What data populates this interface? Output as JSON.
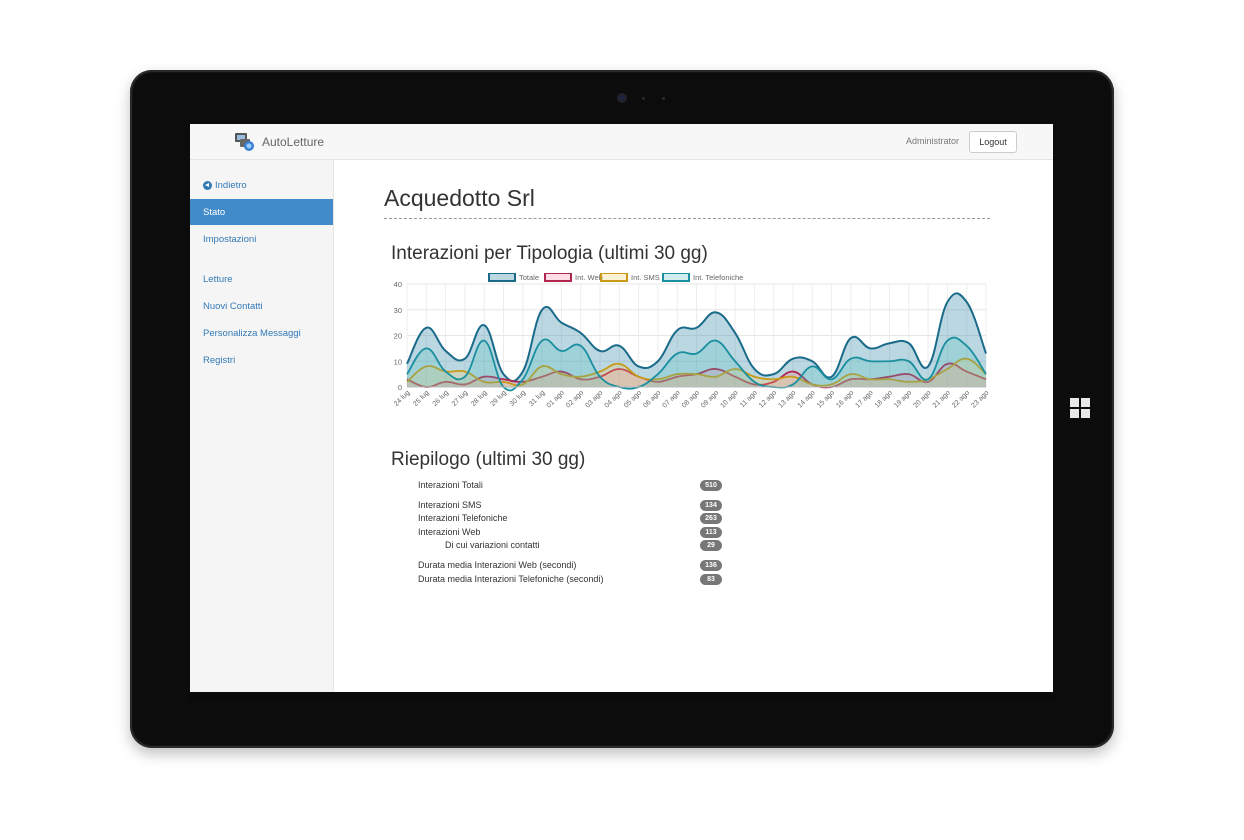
{
  "app": {
    "brand": "AutoLetture",
    "user": "Administrator",
    "logout_label": "Logout"
  },
  "sidebar": {
    "back_label": "Indietro",
    "items": [
      {
        "label": "Stato",
        "active": true
      },
      {
        "label": "Impostazioni",
        "active": false
      },
      {
        "label": "Letture",
        "active": false
      },
      {
        "label": "Nuovi Contatti",
        "active": false
      },
      {
        "label": "Personalizza Messaggi",
        "active": false
      },
      {
        "label": "Registri",
        "active": false
      }
    ]
  },
  "page": {
    "title": "Acquedotto Srl",
    "chart_title": "Interazioni per Tipologia (ultimi 30 gg)",
    "summary_title": "Riepilogo (ultimi 30 gg)"
  },
  "summary": [
    {
      "label": "Interazioni Totali",
      "value": "510",
      "indent": false
    },
    {
      "label": "Interazioni SMS",
      "value": "134",
      "indent": false
    },
    {
      "label": "Interazioni Telefoniche",
      "value": "263",
      "indent": false
    },
    {
      "label": "Interazioni Web",
      "value": "113",
      "indent": false
    },
    {
      "label": "Di cui variazioni contatti",
      "value": "29",
      "indent": true
    },
    {
      "label": "Durata media Interazioni Web (secondi)",
      "value": "136",
      "indent": false
    },
    {
      "label": "Durata media Interazioni Telefoniche (secondi)",
      "value": "83",
      "indent": false
    }
  ],
  "chart_data": {
    "type": "area",
    "categories": [
      "24 lug",
      "25 lug",
      "26 lug",
      "27 lug",
      "28 lug",
      "29 lug",
      "30 lug",
      "31 lug",
      "01 ago",
      "02 ago",
      "03 ago",
      "04 ago",
      "05 ago",
      "06 ago",
      "07 ago",
      "08 ago",
      "09 ago",
      "10 ago",
      "11 ago",
      "12 ago",
      "13 ago",
      "14 ago",
      "15 ago",
      "16 ago",
      "17 ago",
      "18 ago",
      "19 ago",
      "20 ago",
      "21 ago",
      "22 ago",
      "23 ago"
    ],
    "ylim": [
      0,
      40
    ],
    "yticks": [
      0,
      10,
      20,
      30,
      40
    ],
    "grid": true,
    "legend_position": "top",
    "series": [
      {
        "name": "Totale",
        "color": "#1a6b8a",
        "fill": "rgba(60,141,172,0.35)",
        "values": [
          9,
          23,
          14,
          11,
          24,
          5,
          6,
          30,
          25,
          21,
          14,
          16,
          8,
          10,
          22,
          23,
          29,
          21,
          7,
          5,
          11,
          10,
          4,
          19,
          15,
          17,
          17,
          8,
          33,
          33,
          13
        ]
      },
      {
        "name": "Int. Web",
        "color": "#b0264f",
        "fill": "rgba(255,120,150,0.25)",
        "values": [
          3,
          0,
          2,
          1,
          4,
          3,
          2,
          4,
          6,
          3,
          4,
          7,
          4,
          2,
          4,
          5,
          7,
          4,
          1,
          2,
          6,
          1,
          0,
          3,
          3,
          4,
          5,
          2,
          9,
          6,
          3
        ]
      },
      {
        "name": "Int. SMS",
        "color": "#c79a18",
        "fill": "rgba(255,206,86,0.25)",
        "values": [
          2,
          8,
          6,
          6,
          2,
          2,
          1,
          8,
          5,
          4,
          6,
          9,
          4,
          3,
          5,
          5,
          4,
          7,
          4,
          3,
          4,
          1,
          1,
          5,
          3,
          3,
          2,
          3,
          7,
          11,
          5
        ]
      },
      {
        "name": "Int. Telefoniche",
        "color": "#1a8fa0",
        "fill": "rgba(75,192,192,0.25)",
        "values": [
          5,
          15,
          6,
          4,
          18,
          0,
          3,
          18,
          14,
          16,
          4,
          0,
          0,
          5,
          13,
          13,
          18,
          10,
          2,
          0,
          1,
          8,
          3,
          11,
          10,
          10,
          10,
          3,
          18,
          16,
          5
        ]
      }
    ]
  }
}
